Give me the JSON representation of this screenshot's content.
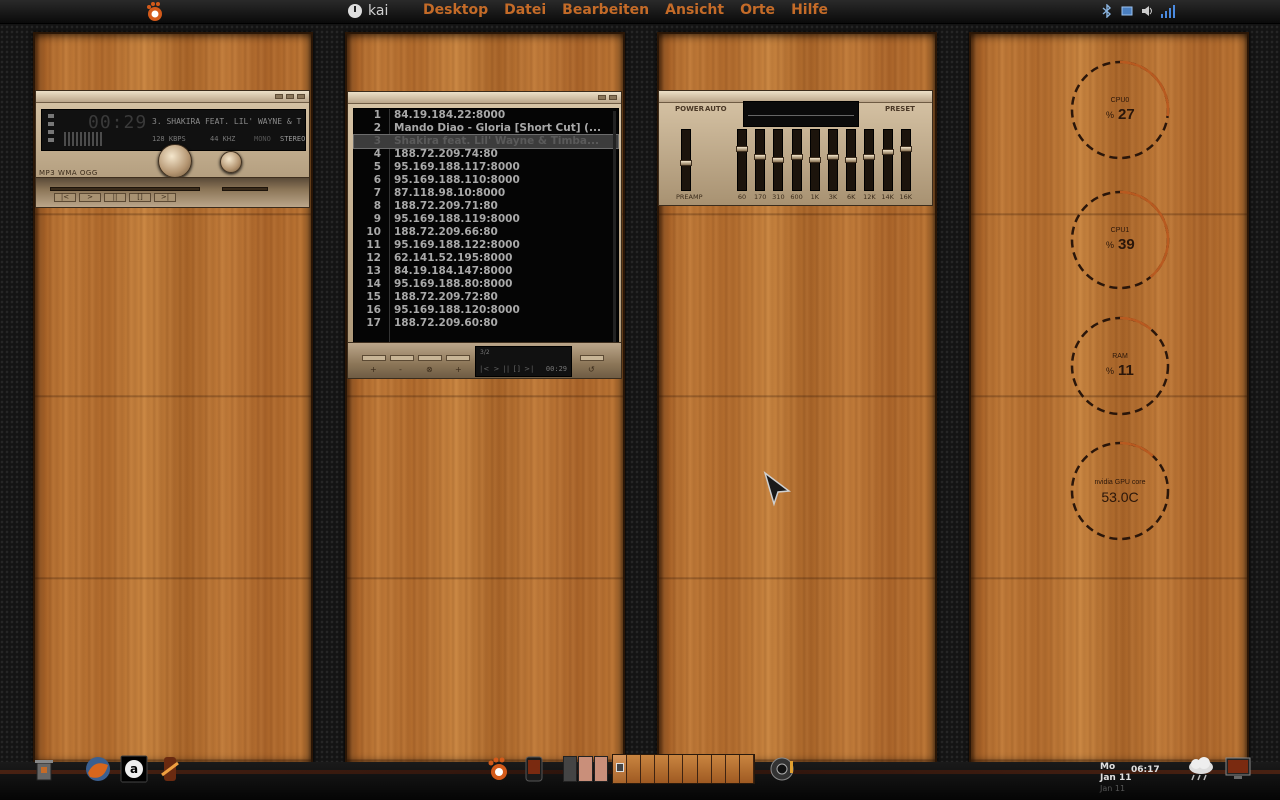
{
  "top_panel": {
    "user": "kai",
    "menu": [
      "Desktop",
      "Datei",
      "Bearbeiten",
      "Ansicht",
      "Orte",
      "Hilfe"
    ]
  },
  "player": {
    "time": "00:29",
    "song": "3. SHAKIRA FEAT. LIL' WAYNE & T",
    "kbps": "128 KBPS",
    "khz": "44 KHZ",
    "mono": "MONO",
    "stereo": "STEREO",
    "formats": "MP3 WMA OGG",
    "transport": [
      "|<",
      ">",
      "||",
      "[]",
      ">|"
    ]
  },
  "playlist": {
    "items": [
      {
        "num": "1",
        "title": "84.19.184.22:8000"
      },
      {
        "num": "2",
        "title": "Mando Diao - Gloria [Short Cut] (..."
      },
      {
        "num": "3",
        "title": "Shakira feat. Lil' Wayne & Timba..."
      },
      {
        "num": "4",
        "title": "188.72.209.74:80"
      },
      {
        "num": "5",
        "title": "95.169.188.117:8000"
      },
      {
        "num": "6",
        "title": "95.169.188.110:8000"
      },
      {
        "num": "7",
        "title": "87.118.98.10:8000"
      },
      {
        "num": "8",
        "title": "188.72.209.71:80"
      },
      {
        "num": "9",
        "title": "95.169.188.119:8000"
      },
      {
        "num": "10",
        "title": "188.72.209.66:80"
      },
      {
        "num": "11",
        "title": "95.169.188.122:8000"
      },
      {
        "num": "12",
        "title": "62.141.52.195:8000"
      },
      {
        "num": "13",
        "title": "84.19.184.147:8000"
      },
      {
        "num": "14",
        "title": "95.169.188.80:8000"
      },
      {
        "num": "15",
        "title": "188.72.209.72:80"
      },
      {
        "num": "16",
        "title": "95.169.188.120:8000"
      },
      {
        "num": "17",
        "title": "188.72.209.60:80"
      }
    ],
    "active_index": 2,
    "count": "3/2",
    "time": "00:29",
    "buttons": [
      "+",
      "-",
      "⊗",
      "+",
      "↺"
    ]
  },
  "equalizer": {
    "power": "POWER",
    "auto": "AUTO",
    "preset": "PRESET",
    "bands": [
      "PREAMP",
      "60",
      "170",
      "310",
      "600",
      "1K",
      "3K",
      "6K",
      "12K",
      "14K",
      "16K"
    ],
    "band_levels": [
      0.55,
      0.3,
      0.45,
      0.5,
      0.45,
      0.5,
      0.45,
      0.5,
      0.45,
      0.35,
      0.3
    ]
  },
  "gauges": [
    {
      "label": "CPU0",
      "unit": "%",
      "value": "27",
      "fraction": 0.27,
      "color": "#b85a20"
    },
    {
      "label": "CPU1",
      "unit": "%",
      "value": "39",
      "fraction": 0.39,
      "color": "#b85a20"
    },
    {
      "label": "RAM",
      "unit": "%",
      "value": "11",
      "fraction": 0.11,
      "color": "#b85a20"
    },
    {
      "label": "nvidia GPU core",
      "unit": "",
      "value": "53.0C",
      "fraction": 0.12,
      "color": "#b85a20"
    }
  ],
  "clock": {
    "day": "Mo",
    "date": "Jan 11",
    "time": "06:17",
    "ghost": "Jan 11"
  },
  "colors": {
    "menu_text": "#c46b28",
    "wood": "#b9712f",
    "gauge_ring": "#2a160a"
  },
  "icons": [
    "foot-logo-icon",
    "power-icon",
    "bluetooth-icon",
    "network-icon",
    "volume-icon",
    "signal-icon",
    "trash-icon",
    "firefox-icon",
    "amarok-icon",
    "scripts-icon",
    "gnome-foot-icon",
    "phone-icon",
    "speaker-icon",
    "weather-icon",
    "monitor-icon"
  ]
}
